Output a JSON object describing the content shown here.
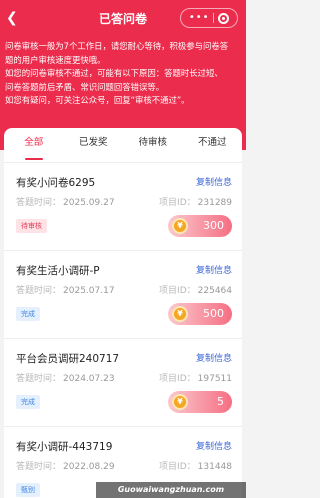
{
  "nav": {
    "title": "已答问卷",
    "back_icon": "chevron-left-icon",
    "capsule_dots": "•••"
  },
  "notice": {
    "lines": [
      "问卷审核一般为7个工作日，请您耐心等待，积极参与问卷答",
      "题的用户审核速度更快哦。",
      "如您的问卷审核不通过，可能有以下原因：答题时长过短、",
      "问卷答题前后矛盾、常识问题回答错误等。",
      "如您有疑问，可关注公众号，回复“审核不通过”。"
    ]
  },
  "tabs": [
    {
      "label": "全部",
      "active": true
    },
    {
      "label": "已发奖",
      "active": false
    },
    {
      "label": "待审核",
      "active": false
    },
    {
      "label": "不通过",
      "active": false
    }
  ],
  "labels": {
    "copy": "复制信息",
    "date_prefix": "答题时间：",
    "id_prefix": "项目ID："
  },
  "surveys": [
    {
      "name": "有奖小问卷6295",
      "date": "2025.09.27",
      "project_id": "231289",
      "status": "待审核",
      "status_type": "pending",
      "reward": "300"
    },
    {
      "name": "有奖生活小调研-P",
      "date": "2025.07.17",
      "project_id": "225464",
      "status": "完成",
      "status_type": "done",
      "reward": "500"
    },
    {
      "name": "平台会员调研240717",
      "date": "2024.07.23",
      "project_id": "197511",
      "status": "完成",
      "status_type": "done",
      "reward": "5"
    },
    {
      "name": "有奖小调研-443719",
      "date": "2022.08.29",
      "project_id": "131448",
      "status": "甄别",
      "status_type": "done",
      "reward": ""
    }
  ],
  "watermark": "Guowaiwangzhuan.com",
  "colors": {
    "brand_red": "#ec2c4c",
    "link_blue": "#3a66d6"
  }
}
